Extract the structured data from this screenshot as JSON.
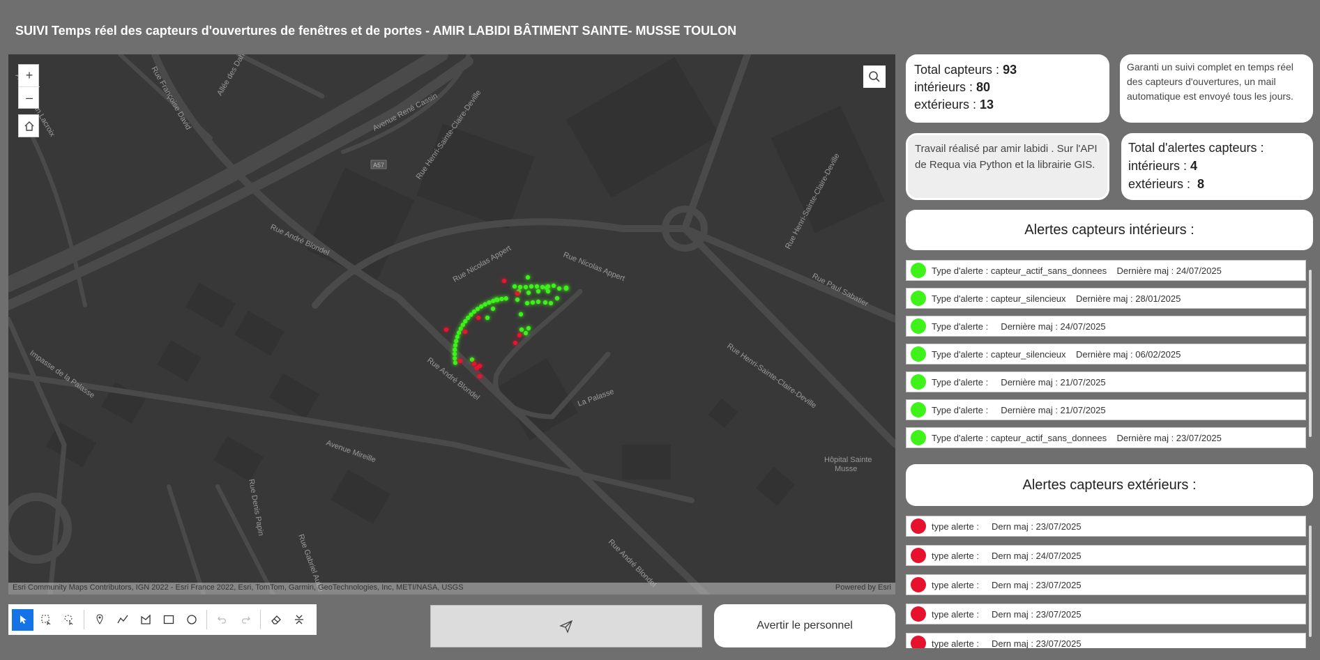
{
  "title": "SUIVI Temps réel des capteurs d'ouvertures de fenêtres et de portes  - AMIR LABIDI BÂTIMENT SAINTE- MUSSE TOULON",
  "map": {
    "zoom_in": "+",
    "zoom_out": "–",
    "attribution": "Esri Community Maps Contributors, IGN 2022 - Esri France 2022, Esri, TomTom, Garmin, GeoTechnologies, Inc, METI/NASA, USGS",
    "powered_by": "Powered by Esri",
    "labels": {
      "avenue_rene_cassin": "Avenue René Cassin",
      "rue_henri_sainte_claire_deville": "Rue Henri-Sainte-Claire-Deville",
      "rue_henri_sainte_claire_deville_2": "Rue Henri-Sainte-Claire-Deville",
      "rue_henri_sainte_claire_deville_3": "Rue Henri-Sainte-Claire-Deville",
      "a57": "A57",
      "rue_andre_blondel": "Rue André Blondel",
      "rue_andre_blondel_2": "Rue André Blondel",
      "rue_andre_blondel_3": "Rue André Blondel",
      "rue_nicolas_appert": "Rue Nicolas Appert",
      "rue_nicolas_appert_2": "Rue Nicolas Appert",
      "rue_paul_sabatier": "Rue Paul Sabatier",
      "impasse_palasse": "Impasse de la Palasse",
      "la_palasse": "La Palasse",
      "avenue_mireille": "Avenue Mireille",
      "rue_denis_papin": "Rue Denis Papin",
      "rue_gabriel_aube": "Rue Gabriel Aube",
      "hopital_1": "Hôpital Sainte",
      "hopital_2": "Musse",
      "allee_dahlias": "Allée des Dahlias",
      "rue_francoise_david": "Rue Françoise David",
      "avenue_jean_lacroix": "Avenue Jean Lacroix"
    },
    "sensor_colors": {
      "ok": "#3ef21a",
      "alert": "#e6122d"
    }
  },
  "toolbar": {
    "tools": [
      "select-pointer",
      "rectangle-select",
      "lasso-select",
      "point",
      "polyline",
      "polygon",
      "rectangle",
      "circle",
      "undo",
      "redo",
      "eraser",
      "collapse"
    ]
  },
  "buttons": {
    "send_icon": "paper-plane-icon",
    "warn_label": "Avertir le personnel"
  },
  "stats": {
    "total_label": "Total capteurs : ",
    "total_value": "93",
    "interieurs_label": "intérieurs : ",
    "interieurs_value": "80",
    "exterieurs_label": "extérieurs : ",
    "exterieurs_value": "13"
  },
  "info": {
    "text": " Garanti un suivi complet en temps réel des capteurs d'ouvertures, un mail automatique est envoyé tous les jours."
  },
  "credits": {
    "text": " Travail réalisé par amir labidi . Sur l'API de Requa via Python et la librairie GIS."
  },
  "alerts_totals": {
    "title": "Total d'alertes capteurs :",
    "interieurs_label": "intérieurs : ",
    "interieurs_value": "4",
    "exterieurs_label": "extérieurs :  ",
    "exterieurs_value": "8"
  },
  "interior_alerts": {
    "heading": "Alertes capteurs intérieurs :",
    "rows": [
      {
        "text": "Type d'alerte : capteur_actif_sans_donnees    Dernière maj : 24/07/2025"
      },
      {
        "text": "Type d'alerte : capteur_silencieux    Dernière maj : 28/01/2025"
      },
      {
        "text": "Type d'alerte :     Dernière maj : 24/07/2025"
      },
      {
        "text": "Type d'alerte : capteur_silencieux    Dernière maj : 06/02/2025"
      },
      {
        "text": "Type d'alerte :     Dernière maj : 21/07/2025"
      },
      {
        "text": "Type d'alerte :     Dernière maj : 21/07/2025"
      },
      {
        "text": "Type d'alerte : capteur_actif_sans_donnees    Dernière maj : 23/07/2025"
      }
    ]
  },
  "exterior_alerts": {
    "heading": "Alertes capteurs extérieurs :",
    "rows": [
      {
        "text": "type alerte :     Dern maj : 23/07/2025"
      },
      {
        "text": "type alerte :     Dern maj : 24/07/2025"
      },
      {
        "text": "type alerte :     Dern maj : 23/07/2025"
      },
      {
        "text": "type alerte :     Dern maj : 23/07/2025"
      },
      {
        "text": "type alerte :     Dern maj : 23/07/2025"
      }
    ]
  }
}
